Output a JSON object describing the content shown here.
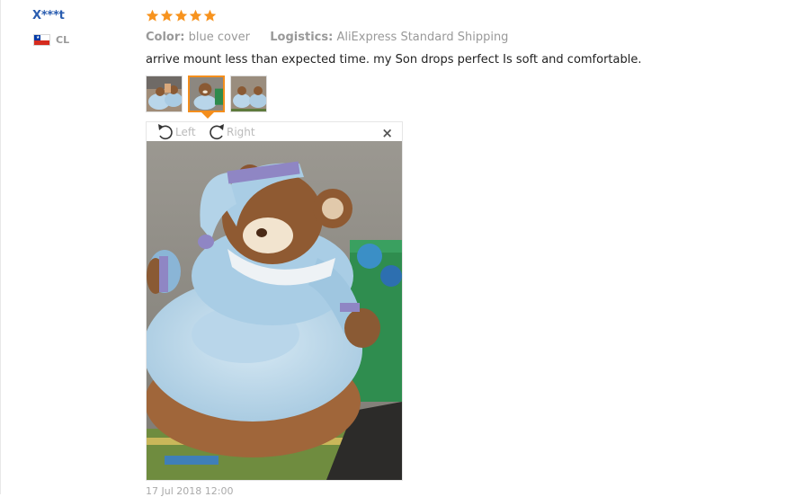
{
  "review": {
    "user": "X***t",
    "country_code": "CL",
    "rating": 5,
    "color_label": "Color:",
    "color_value": "blue cover",
    "logistics_label": "Logistics:",
    "logistics_value": "AliExpress Standard Shipping",
    "text": "arrive mount less than expected time. my Son drops perfect Is soft and comfortable.",
    "thumbnails": [
      "thumbnail-1",
      "thumbnail-2",
      "thumbnail-3"
    ],
    "selected_thumbnail": 2
  },
  "viewer": {
    "rotate_left_label": "Left",
    "rotate_right_label": "Right",
    "close_label": "×"
  },
  "footer": {
    "date": "17 Jul 2018 12:00"
  },
  "colors": {
    "username": "#2a5db0",
    "star": "#f7931e",
    "selected_border": "#f48e1c",
    "meta_text": "#999999"
  }
}
